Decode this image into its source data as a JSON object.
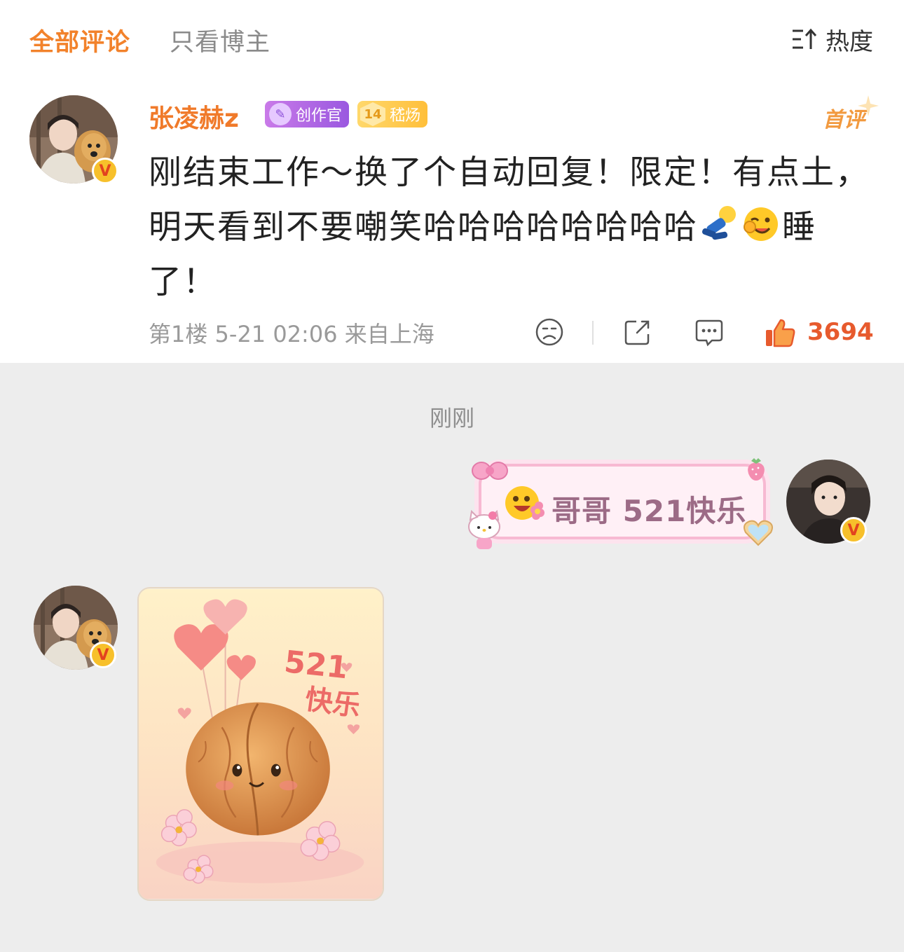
{
  "tabs": {
    "all": "全部评论",
    "host": "只看博主",
    "sort_label": "热度"
  },
  "comment": {
    "username": "张凌赫z",
    "badge_creator": "创作官",
    "badge_fan_level": "14",
    "badge_fan_name": "嵇炀",
    "first_tag": "首评",
    "text_part1": "刚结束工作～换了个自动回复！限定！有点土，明天看到不要嘲笑哈哈哈哈哈哈哈哈",
    "text_part2": "睡了！",
    "meta": "第1楼 5-21 02:06 来自上海",
    "likes": "3694"
  },
  "chat": {
    "time": "刚刚",
    "my_message": "哥哥 521快乐",
    "sticker_text_1": "521",
    "sticker_text_2": "快乐"
  },
  "colors": {
    "accent": "#f2822b",
    "like": "#e75a2d",
    "bubble_pink": "#fff0f6"
  }
}
